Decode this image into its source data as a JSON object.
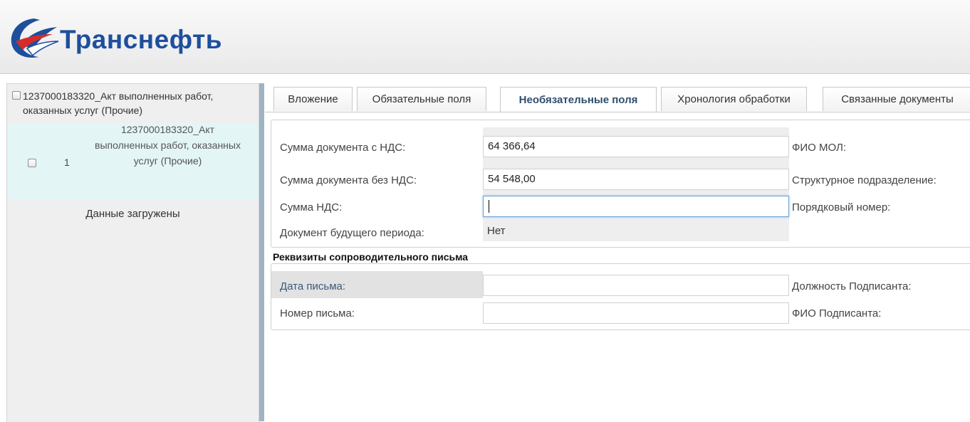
{
  "header": {
    "logo_text": "Транснефть",
    "colors": {
      "logo_blue": "#1d4f9c",
      "logo_red": "#d52b2b"
    }
  },
  "left_panel": {
    "document_group_label": "1237000183320_Акт выполненных работ, оказанных услуг (Прочие)",
    "row": {
      "number": "1",
      "name": "1237000183320_Акт выполненных работ, оказанных услуг (Прочие)"
    },
    "status_text": "Данные загружены"
  },
  "tabs": [
    {
      "label": "Вложение",
      "active": false
    },
    {
      "label": "Обязательные поля",
      "active": false
    },
    {
      "label": "Необязательные поля",
      "active": true
    },
    {
      "label": "Хронология обработки",
      "active": false
    },
    {
      "label": "Связанные документы",
      "active": false
    }
  ],
  "optional_fields": {
    "sum_with_vat": {
      "label": "Сумма документа с НДС:",
      "value": "64 366,64"
    },
    "sum_without_vat": {
      "label": "Сумма документа без НДС:",
      "value": "54 548,00"
    },
    "vat_sum": {
      "label": "Сумма НДС:",
      "value": ""
    },
    "future_period": {
      "label": "Документ будущего периода:",
      "value": "Нет"
    },
    "mol_name": {
      "label": "ФИО МОЛ:"
    },
    "structural_unit": {
      "label": "Структурное подразделение:"
    },
    "serial_number": {
      "label": "Порядковый номер:"
    }
  },
  "cover_letter": {
    "section_title": "Реквизиты сопроводительного письма",
    "letter_date": {
      "label": "Дата письма:",
      "value": ""
    },
    "letter_number": {
      "label": "Номер письма:",
      "value": ""
    },
    "signer_position": {
      "label": "Должность Подписанта:"
    },
    "signer_name": {
      "label": "ФИО Подписанта:"
    }
  }
}
